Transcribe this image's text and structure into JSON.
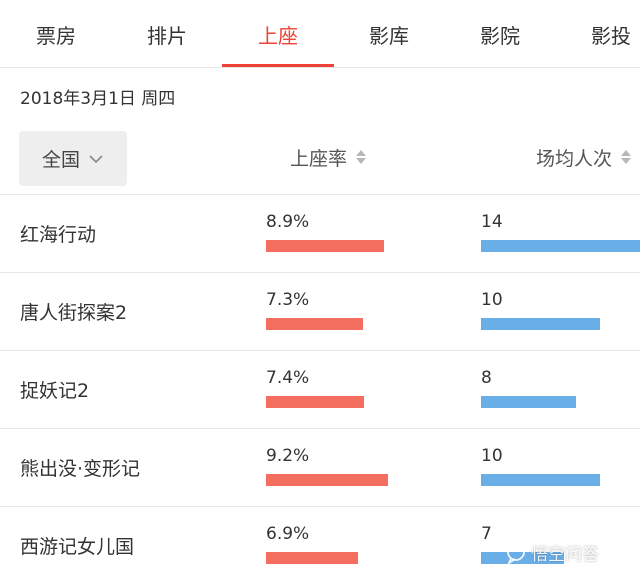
{
  "tabs": [
    {
      "label": "票房",
      "active": false
    },
    {
      "label": "排片",
      "active": false
    },
    {
      "label": "上座",
      "active": true
    },
    {
      "label": "影库",
      "active": false
    },
    {
      "label": "影院",
      "active": false
    },
    {
      "label": "影投",
      "active": false
    }
  ],
  "date": "2018年3月1日 周四",
  "region_filter": {
    "value": "全国",
    "icon": "chevron-down-icon"
  },
  "columns": [
    {
      "label": "上座率",
      "icon": "sort-icon"
    },
    {
      "label": "场均人次",
      "icon": "sort-icon"
    }
  ],
  "rows": [
    {
      "name": "红海行动",
      "rate": "8.9%",
      "rate_value": 8.9,
      "count": "14",
      "count_value": 14
    },
    {
      "name": "唐人街探案2",
      "rate": "7.3%",
      "rate_value": 7.3,
      "count": "10",
      "count_value": 10
    },
    {
      "name": "捉妖记2",
      "rate": "7.4%",
      "rate_value": 7.4,
      "count": "8",
      "count_value": 8
    },
    {
      "name": "熊出没·变形记",
      "rate": "9.2%",
      "rate_value": 9.2,
      "count": "10",
      "count_value": 10
    },
    {
      "name": "西游记女儿国",
      "rate": "6.9%",
      "rate_value": 6.9,
      "count": "7",
      "count_value": 7
    }
  ],
  "colors": {
    "accent": "#ef4238",
    "rate_bar": "#f36e5f",
    "count_bar": "#6aaee8"
  },
  "watermark": {
    "text": "悟空问答",
    "icon": "speech-bubble-icon"
  }
}
